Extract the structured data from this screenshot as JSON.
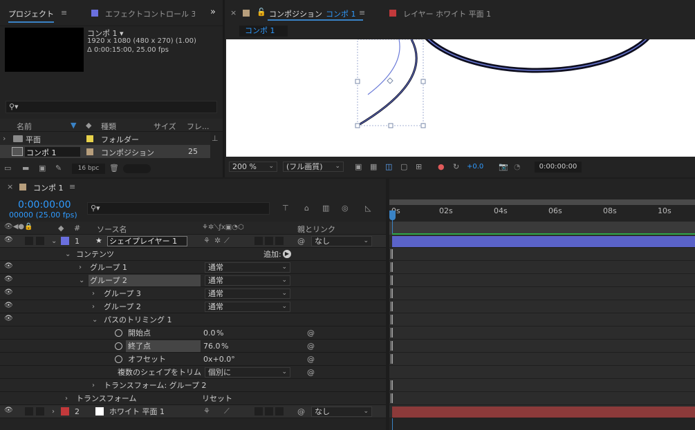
{
  "project_panel": {
    "tab_label": "プロジェクト",
    "effect_tab_label": "エフェクトコントロール 3",
    "comp_name": "コンポ 1 ▾",
    "comp_info_1": "1920 x 1080 (480 x 270) (1.00)",
    "comp_info_2": "Δ 0:00:15:00, 25.00 fps",
    "search_placeholder": "",
    "col_name": "名前",
    "col_type": "種類",
    "col_size": "サイズ",
    "col_frame": "フレ...",
    "items": [
      {
        "name": "平面",
        "type": "フォルダー",
        "size": "",
        "color": "#e7d24a"
      },
      {
        "name": "コンポ 1",
        "type": "コンポジション",
        "size": "25",
        "color": "#b79e7c"
      }
    ],
    "bpc_label": "16 bpc"
  },
  "comp_panel": {
    "tab_label": "コンポジション",
    "tab_comp_name": "コンポ 1",
    "layer_tab_label": "レイヤー ホワイト 平面 1",
    "sub_tab": "コンポ 1",
    "zoom": "200 %",
    "quality": "(フル画質)",
    "exposure": "+0.0",
    "timecode": "0:00:00:00"
  },
  "timeline": {
    "tab_label": "コンポ 1",
    "timecode": "0:00:00:00",
    "frames": "00000 (25.00 fps)",
    "col_source": "ソース名",
    "col_parent": "親とリンク",
    "col_hash": "#",
    "ruler": [
      "0s",
      "02s",
      "04s",
      "06s",
      "08s",
      "10s"
    ],
    "layer1": {
      "num": "1",
      "name": "シェイプレイヤー 1",
      "parent": "なし"
    },
    "contents": "コンテンツ",
    "add_label": "追加:",
    "group1": "グループ 1",
    "group2": "グループ 2",
    "group3": "グループ 3",
    "group2b": "グループ 2",
    "blend_normal": "通常",
    "trim_paths": "パスのトリミング 1",
    "start_label": "開始点",
    "start_value": "0.0",
    "end_label": "終了点",
    "end_value": "76.0",
    "percent": "%",
    "offset_label": "オフセット",
    "offset_value": "0x+0.0°",
    "trim_multi_label": "複数のシェイプをトリム",
    "trim_multi_value": "個別に",
    "transform_group2": "トランスフォーム: グループ 2",
    "transform": "トランスフォーム",
    "reset": "リセット",
    "layer2": {
      "num": "2",
      "name": "ホワイト 平面 1",
      "parent": "なし"
    },
    "add_icon": "play-icon"
  },
  "colors": {
    "accent": "#2f9bff",
    "layer1_label": "#6a6fde",
    "layer2_label": "#c2393b",
    "layer1_bar": "#5a63c9",
    "layer2_bar": "#8c3a3a"
  }
}
